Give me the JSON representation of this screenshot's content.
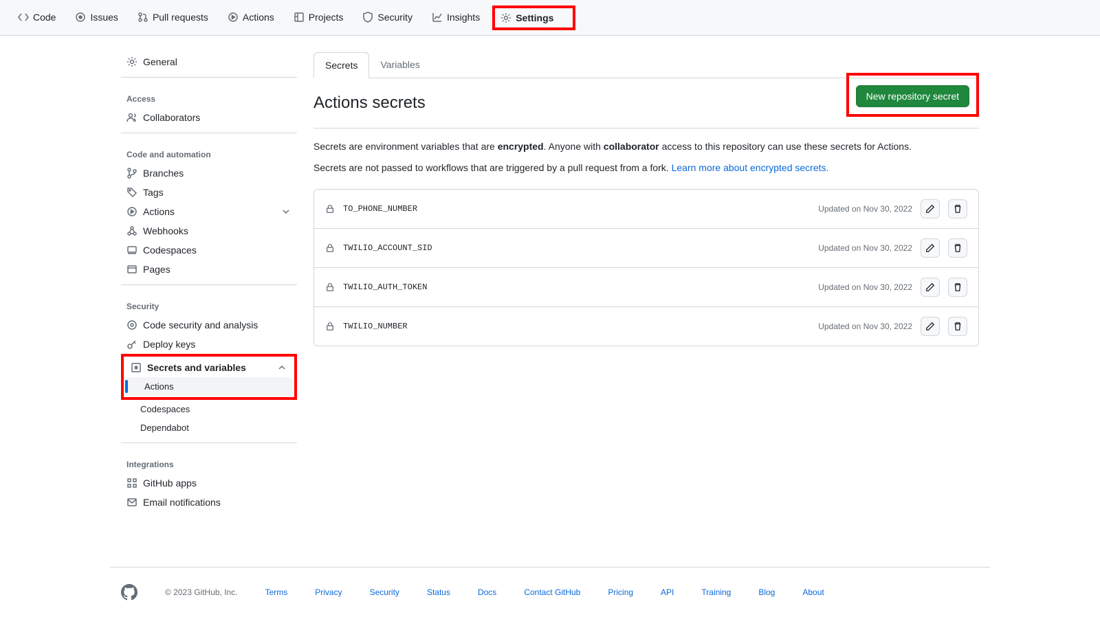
{
  "topnav": {
    "code": "Code",
    "issues": "Issues",
    "pulls": "Pull requests",
    "actions": "Actions",
    "projects": "Projects",
    "security": "Security",
    "insights": "Insights",
    "settings": "Settings"
  },
  "sidebar": {
    "general": "General",
    "sections": {
      "access": "Access",
      "code_automation": "Code and automation",
      "security": "Security",
      "integrations": "Integrations"
    },
    "items": {
      "collaborators": "Collaborators",
      "branches": "Branches",
      "tags": "Tags",
      "actions": "Actions",
      "webhooks": "Webhooks",
      "codespaces": "Codespaces",
      "pages": "Pages",
      "code_security": "Code security and analysis",
      "deploy_keys": "Deploy keys",
      "secrets_vars": "Secrets and variables",
      "sv_actions": "Actions",
      "sv_codespaces": "Codespaces",
      "sv_dependabot": "Dependabot",
      "github_apps": "GitHub apps",
      "email_notif": "Email notifications"
    }
  },
  "tabs": {
    "secrets": "Secrets",
    "variables": "Variables"
  },
  "page": {
    "title": "Actions secrets",
    "new_btn": "New repository secret",
    "desc1a": "Secrets are environment variables that are ",
    "desc1b": "encrypted",
    "desc1c": ". Anyone with ",
    "desc1d": "collaborator",
    "desc1e": " access to this repository can use these secrets for Actions.",
    "desc2a": "Secrets are not passed to workflows that are triggered by a pull request from a fork. ",
    "desc2b": "Learn more about encrypted secrets."
  },
  "secrets": [
    {
      "name": "TO_PHONE_NUMBER",
      "updated": "Updated on Nov 30, 2022"
    },
    {
      "name": "TWILIO_ACCOUNT_SID",
      "updated": "Updated on Nov 30, 2022"
    },
    {
      "name": "TWILIO_AUTH_TOKEN",
      "updated": "Updated on Nov 30, 2022"
    },
    {
      "name": "TWILIO_NUMBER",
      "updated": "Updated on Nov 30, 2022"
    }
  ],
  "footer": {
    "copyright": "© 2023 GitHub, Inc.",
    "links": {
      "terms": "Terms",
      "privacy": "Privacy",
      "security": "Security",
      "status": "Status",
      "docs": "Docs",
      "contact": "Contact GitHub",
      "pricing": "Pricing",
      "api": "API",
      "training": "Training",
      "blog": "Blog",
      "about": "About"
    }
  }
}
